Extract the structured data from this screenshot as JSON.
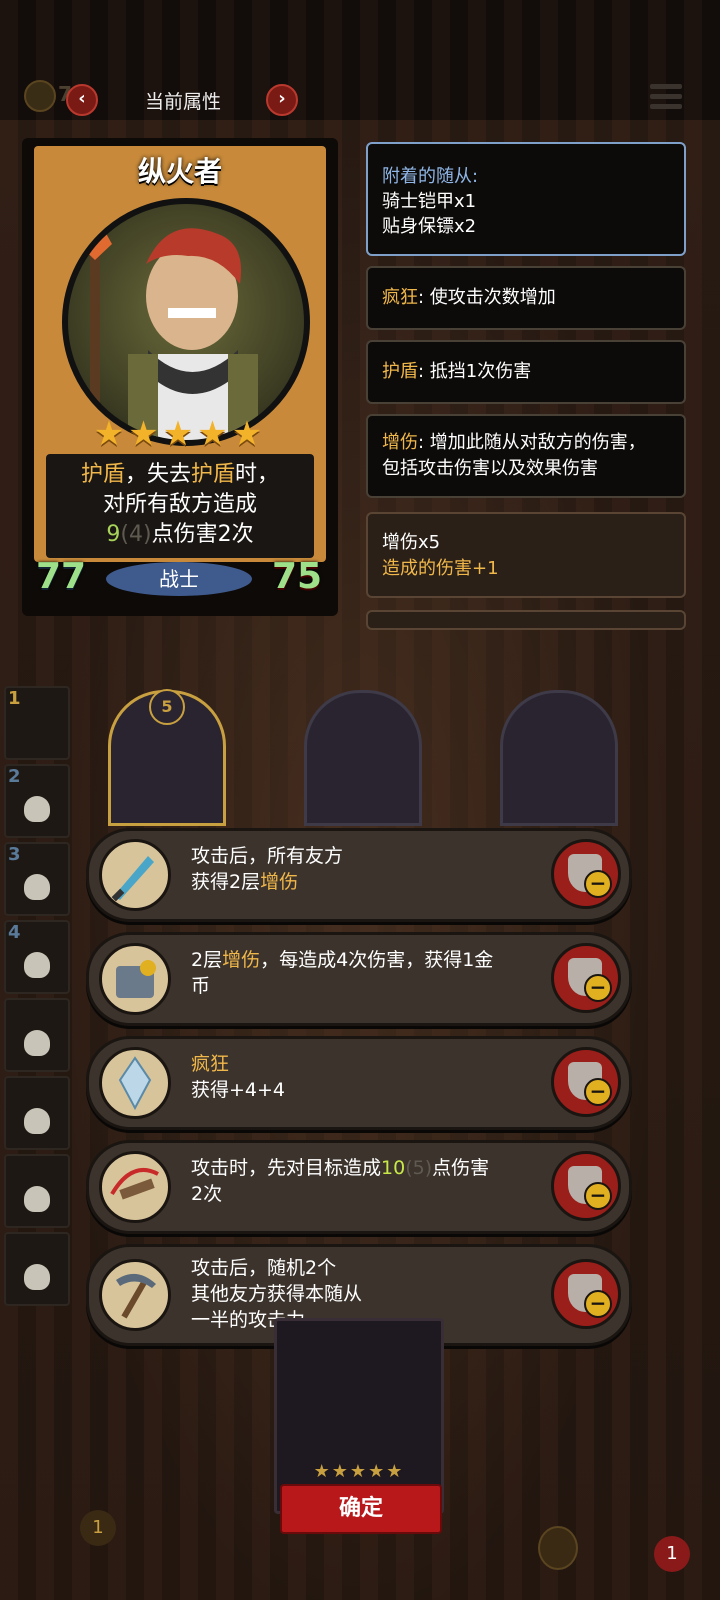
{
  "header": {
    "coin_text": "7",
    "title": "当前属性",
    "prev_label": "‹",
    "next_label": "›"
  },
  "hero": {
    "name": "纵火者",
    "stars": "★★★★★",
    "ability": {
      "kw1": "护盾",
      "sep1": "，失去",
      "kw2": "护盾",
      "sep2": "时，",
      "line2": "对所有敌方造成",
      "dmg": "9",
      "dmg_base": "(4)",
      "line3_rest": "点伤害2次"
    },
    "attack": "77",
    "health": "75",
    "class": "战士",
    "level": "5"
  },
  "info_panels": {
    "attached": {
      "head": "附着的随从:",
      "line1": "骑士铠甲x1",
      "line2": "贴身保镖x2"
    },
    "frenzy": {
      "key": "疯狂",
      "desc": ": 使攻击次数增加"
    },
    "shield": {
      "key": "护盾",
      "desc": ": 抵挡1次伤害"
    },
    "boost": {
      "key": "增伤",
      "desc": ": 增加此随从对敌方的伤害，",
      "desc2": "包括攻击伤害以及效果伤害"
    },
    "stack": {
      "line1": "增伤x5",
      "line2": "造成的伤害+1"
    }
  },
  "team_slots": [
    "1",
    "2",
    "3",
    "4"
  ],
  "relics": [
    {
      "icon": "dagger-icon",
      "l1_pre": "攻击后，所有友方",
      "l2_pre": "获得2层",
      "l2_kw": "增伤",
      "l2_post": ""
    },
    {
      "icon": "machine-icon",
      "l1_pre": "2层",
      "l1_kw": "增伤",
      "l1_post": "，每造成4次伤害，获得1金",
      "l2_pre": "币"
    },
    {
      "icon": "crystal-icon",
      "l1_kw": "疯狂",
      "l2_pre": "获得+4+4"
    },
    {
      "icon": "crossbow-icon",
      "l1_pre": "攻击时，先对目标造成",
      "l1_green": "10",
      "l1_dim": "(5)",
      "l1_post": "点伤害",
      "l2_pre": "2次"
    },
    {
      "icon": "pickaxe-icon",
      "l1_pre": "攻击后，随机2个",
      "l2_pre": "其他友方获得本随从",
      "l3_pre": "一半的攻击力"
    }
  ],
  "confirm_label": "确定",
  "badges": {
    "left": "1",
    "right": "1"
  }
}
